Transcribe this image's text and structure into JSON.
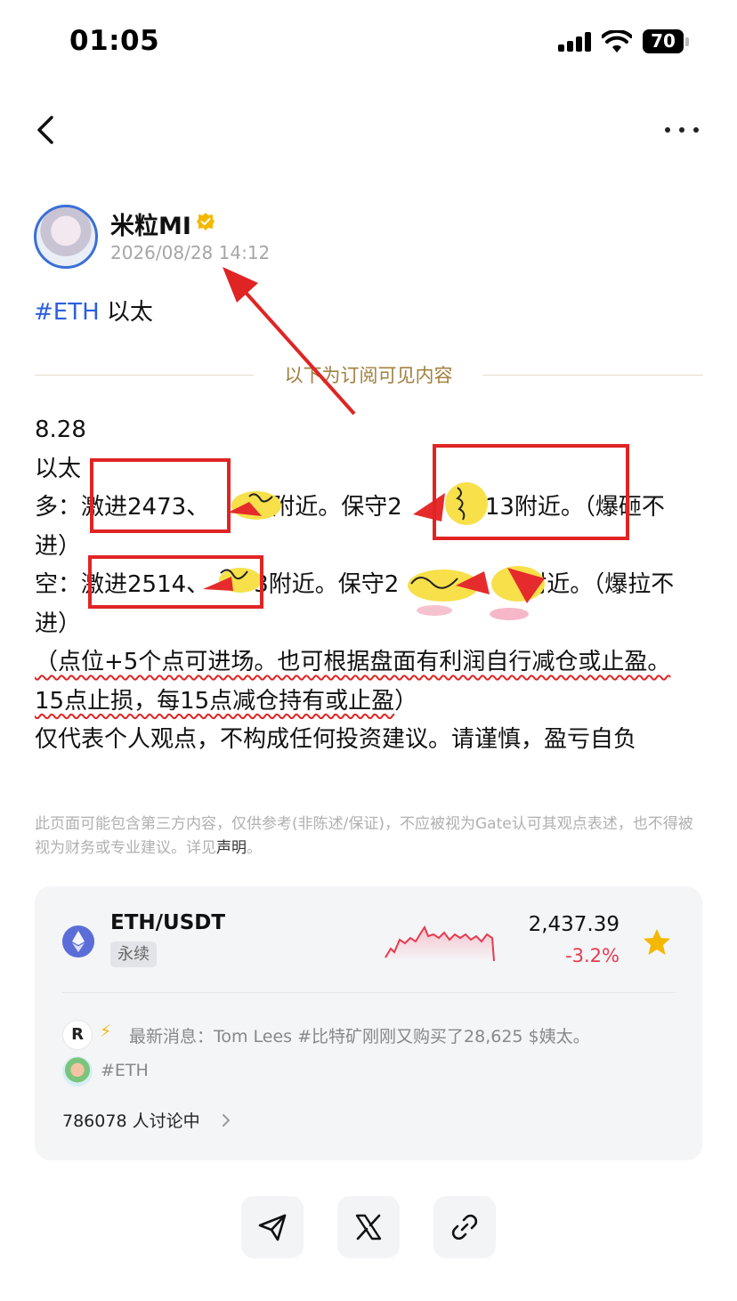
{
  "status_bar": {
    "time": "01:05",
    "battery": "70"
  },
  "author": {
    "name": "米粒MI",
    "post_time": "2026/08/28 14:12"
  },
  "post": {
    "hashtag": "#ETH",
    "topic": "以太",
    "subscriber_divider": "以下为订阅可见内容",
    "date_line": "8.28",
    "asset_line": "以太",
    "long_prefix": "多：",
    "long_aggressive": "激进2473、",
    "long_mid": "附近。保守2",
    "long_conservative": "2413附近。（爆砸不进）",
    "short_prefix": "空：",
    "short_aggressive": "激进2514、",
    "short_mid": "3附近。保守2",
    "short_tail": "附近。（爆拉不进）",
    "note_underlined": "（点位+5个点可进场。也可根据盘面有利润自行减仓或止盈。15点止损，每15点减仓持有或止盈",
    "note_close": "）",
    "disclaimer_line": "仅代表个人观点，不构成任何投资建议。请谨慎，盈亏自负"
  },
  "legal_notice": {
    "text": "此页面可能包含第三方内容，仅供参考(非陈述/保证)，不应被视为Gate认可其观点表述，也不得被视为财务或专业建议。详见",
    "link": "声明",
    "end": "。"
  },
  "market_card": {
    "pair": "ETH/USDT",
    "contract_type": "永续",
    "price": "2,437.39",
    "change": "-3.2%",
    "change_color": "#e83a4f",
    "news_logo": "R",
    "news_text": "最新消息：Tom Lees #比特矿刚刚又购买了28,625 $姨太。",
    "topic_tag": "#ETH",
    "discussion": "786078 人讨论中"
  },
  "colors": {
    "accent_blue": "#2c5fde",
    "annotation_red": "#e02424",
    "star_yellow": "#f5b800"
  },
  "icons": {
    "back": "chevron-left-icon",
    "more": "more-horizontal-icon",
    "verified": "verified-badge-icon",
    "favorite": "star-icon",
    "share_telegram": "send-icon",
    "share_x": "x-logo-icon",
    "share_link": "link-icon"
  }
}
